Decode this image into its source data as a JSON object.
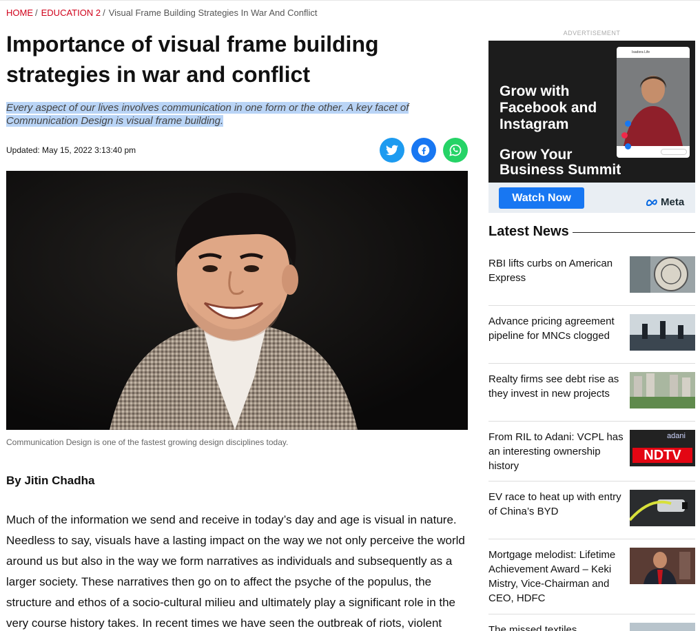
{
  "breadcrumb": {
    "home": "HOME",
    "section": "EDUCATION 2",
    "current": "Visual Frame Building Strategies In War And Conflict",
    "sep": "/"
  },
  "article": {
    "title": "Importance of visual frame building strategies in war and conflict",
    "summary": "Every aspect of our lives involves communication in one form or the other. A key facet of Communication Design is visual frame building.",
    "updated_label": "Updated:",
    "updated_value": "May 15, 2022 3:13:40 pm",
    "caption": "Communication Design is one of the fastest growing design disciplines today.",
    "byline": "By Jitin Chadha",
    "body": "Much of the information we send and receive in today’s day and age is visual in nature. Needless to say, visuals have a lasting impact on the way we not only perceive the world around us but also in the way we form narratives as individuals and subsequently as a larger society. These narratives then go on to affect the psyche of the populus, the structure and ethos of a socio-cultural milieu and ultimately play a significant role in the very course history takes. In recent times we have seen the outbreak of riots, violent"
  },
  "share": {
    "twitter_icon": "twitter-icon",
    "facebook_icon": "facebook-icon",
    "whatsapp_icon": "whatsapp-icon"
  },
  "ad": {
    "label": "ADVERTISEMENT",
    "headline_1": "Grow with",
    "headline_2": "Facebook and",
    "headline_3": "Instagram",
    "subline_1": "Grow Your",
    "subline_2": "Business Summit",
    "cta": "Watch Now",
    "brand": "Meta",
    "phone_account": "Isadora Life"
  },
  "latest_news": {
    "heading": "Latest News",
    "items": [
      {
        "title": "RBI lifts curbs on American Express"
      },
      {
        "title": "Advance pricing agreement pipeline for MNCs clogged"
      },
      {
        "title": "Realty firms see debt rise as they invest in new projects"
      },
      {
        "title": "From RIL to Adani: VCPL has an interesting ownership history",
        "thumb_text_1": "adani",
        "thumb_text_2": "NDTV"
      },
      {
        "title": "EV race to heat up with entry of China’s BYD"
      },
      {
        "title": "Mortgage melodist: Lifetime Achievement Award – Keki Mistry, Vice-Chairman and CEO, HDFC"
      },
      {
        "title": "The missed textiles"
      }
    ]
  },
  "colors": {
    "accent": "#d0021b",
    "twitter": "#1d9bf0",
    "facebook": "#1877f2",
    "whatsapp": "#25d366",
    "highlight": "#b9d4f6"
  }
}
